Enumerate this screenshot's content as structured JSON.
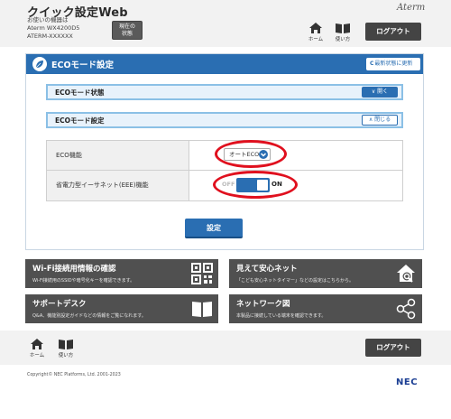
{
  "header": {
    "app_title": "クイック設定Web",
    "device_line1": "お使いの機器は",
    "device_line2": "Aterm WX4200D5",
    "device_line3": "ATERM-XXXXXX",
    "status_btn_line1": "現在の",
    "status_btn_line2": "状態",
    "brand": "Aterm",
    "home_label": "ホーム",
    "help_label": "使い方",
    "logout_label": "ログアウト"
  },
  "panel": {
    "title": "ECOモード設定",
    "refresh_label": "最新状態に更新",
    "sections": [
      {
        "title": "ECOモード状態",
        "button_label": "開く",
        "state": "collapsed"
      },
      {
        "title": "ECOモード設定",
        "button_label": "閉じる",
        "state": "expanded"
      }
    ],
    "rows": [
      {
        "label": "ECO機能",
        "value": "オートECO"
      },
      {
        "label": "省電力型イーサネット(EEE)機能",
        "toggle_off_label": "OFF",
        "toggle_on_label": "ON",
        "toggle_state": "on"
      }
    ],
    "apply_label": "設定"
  },
  "tiles": [
    {
      "title": "Wi-Fi接続用情報の確認",
      "desc": "Wi-Fi接続用のSSIDや暗号化キーを確認できます。",
      "icon": "qr-code-icon"
    },
    {
      "title": "見えて安心ネット",
      "desc": "「こども安心ネットタイマー」などの設定はこちらから。",
      "icon": "house-search-icon"
    },
    {
      "title": "サポートデスク",
      "desc": "Q&A、機能別設定ガイドなどの情報をご覧になれます。",
      "icon": "book-icon"
    },
    {
      "title": "ネットワーク図",
      "desc": "本製品に接続している端末を確認できます。",
      "icon": "network-icon"
    }
  ],
  "footer": {
    "home_label": "ホーム",
    "help_label": "使い方",
    "logout_label": "ログアウト",
    "copyright": "Copyright© NEC Platforms, Ltd. 2001-2023",
    "logo": "NEC"
  },
  "colors": {
    "primary": "#2a6eb2",
    "dark_tile": "#505050",
    "highlight": "#e0101e"
  }
}
